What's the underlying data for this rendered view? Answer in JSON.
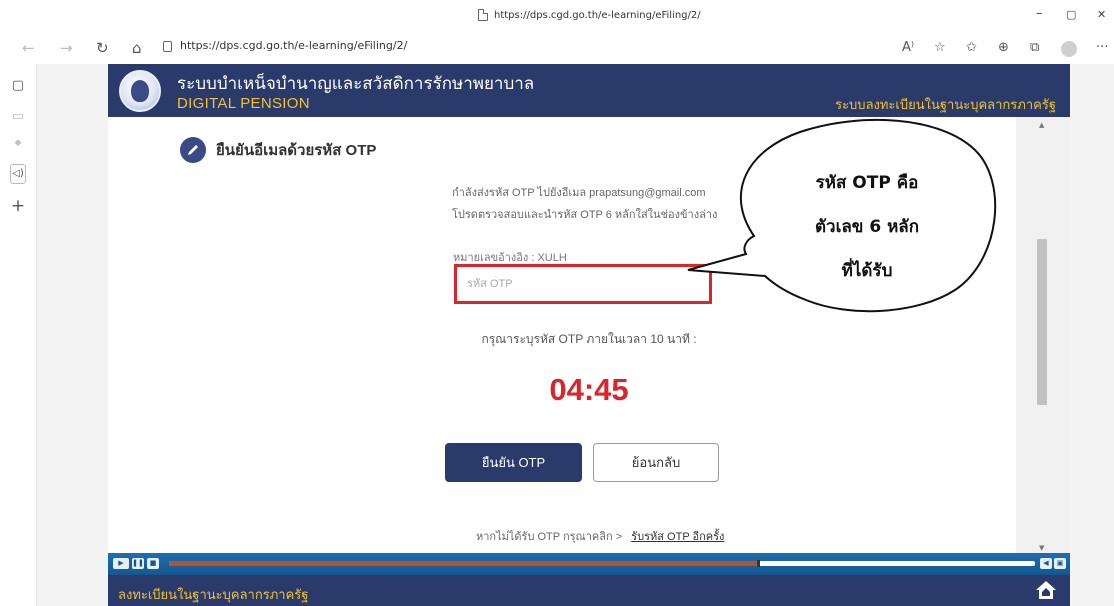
{
  "browser": {
    "window_title_url": "https://dps.cgd.go.th/e-learning/eFiling/2/",
    "address_url": "https://dps.cgd.go.th/e-learning/eFiling/2/",
    "window_controls": {
      "minimize": "–",
      "restore": "▢",
      "close": "✕"
    },
    "nav": {
      "back": "←",
      "forward": "→",
      "refresh": "↻",
      "home": "⌂"
    },
    "toolbar": {
      "read_aloud": "A⁾",
      "add_favorite": "☆",
      "favorites": "✩",
      "collections": "⊕",
      "extensions": "⧉",
      "more": "···"
    },
    "sidebar": {
      "tabs": "▢",
      "page": "▭",
      "shield": "◆",
      "speaker": "◁)",
      "add": "+"
    }
  },
  "course": {
    "title": "ระบบบำเหน็จบำนาญและสวัสดิการรักษาพยาบาล",
    "subtitle": "DIGITAL PENSION",
    "header_right": "ระบบลงทะเบียนในฐานะบุคลากรภาครัฐ",
    "footer_text": "ลงทะเบียนในฐานะบุคลากรภาครัฐ"
  },
  "otp_form": {
    "heading": "ยืนยันอีเมลด้วยรหัส OTP",
    "sent_message": "กำลังส่งรหัส OTP ไปยังอีเมล prapatsung@gmail.com",
    "instruction": "โปรดตรวจสอบและนำรหัส OTP 6 หลักใส่ในช่องข้างล่าง",
    "reference_label": "หมายเลขอ้างอิง : XULH",
    "input_value": "",
    "input_placeholder": "รหัส OTP",
    "timer_label": "กรุณาระบุรหัส OTP ภายในเวลา 10 นาที :",
    "timer_value": "04:45",
    "confirm_label": "ยืนยัน OTP",
    "back_label": "ย้อนกลับ",
    "resend_prompt": "หากไม่ได้รับ OTP กรุณาคลิก >",
    "resend_link": "รับรหัส OTP อีกครั้ง"
  },
  "callout": {
    "line1": "รหัส OTP คือ",
    "line2": "ตัวเลข 6 หลัก",
    "line3": "ที่ได้รับ"
  },
  "player": {
    "play": "▶",
    "pause": "❚❚",
    "stop": "■",
    "volume": "◀",
    "fullscreen": "▣",
    "progress_fraction": 0.68
  },
  "colors": {
    "navy": "#2a3a6b",
    "gold": "#f1c232",
    "red": "#d9252b",
    "player_blue": "#1f6fb0",
    "progress_brown": "#b3522d"
  }
}
